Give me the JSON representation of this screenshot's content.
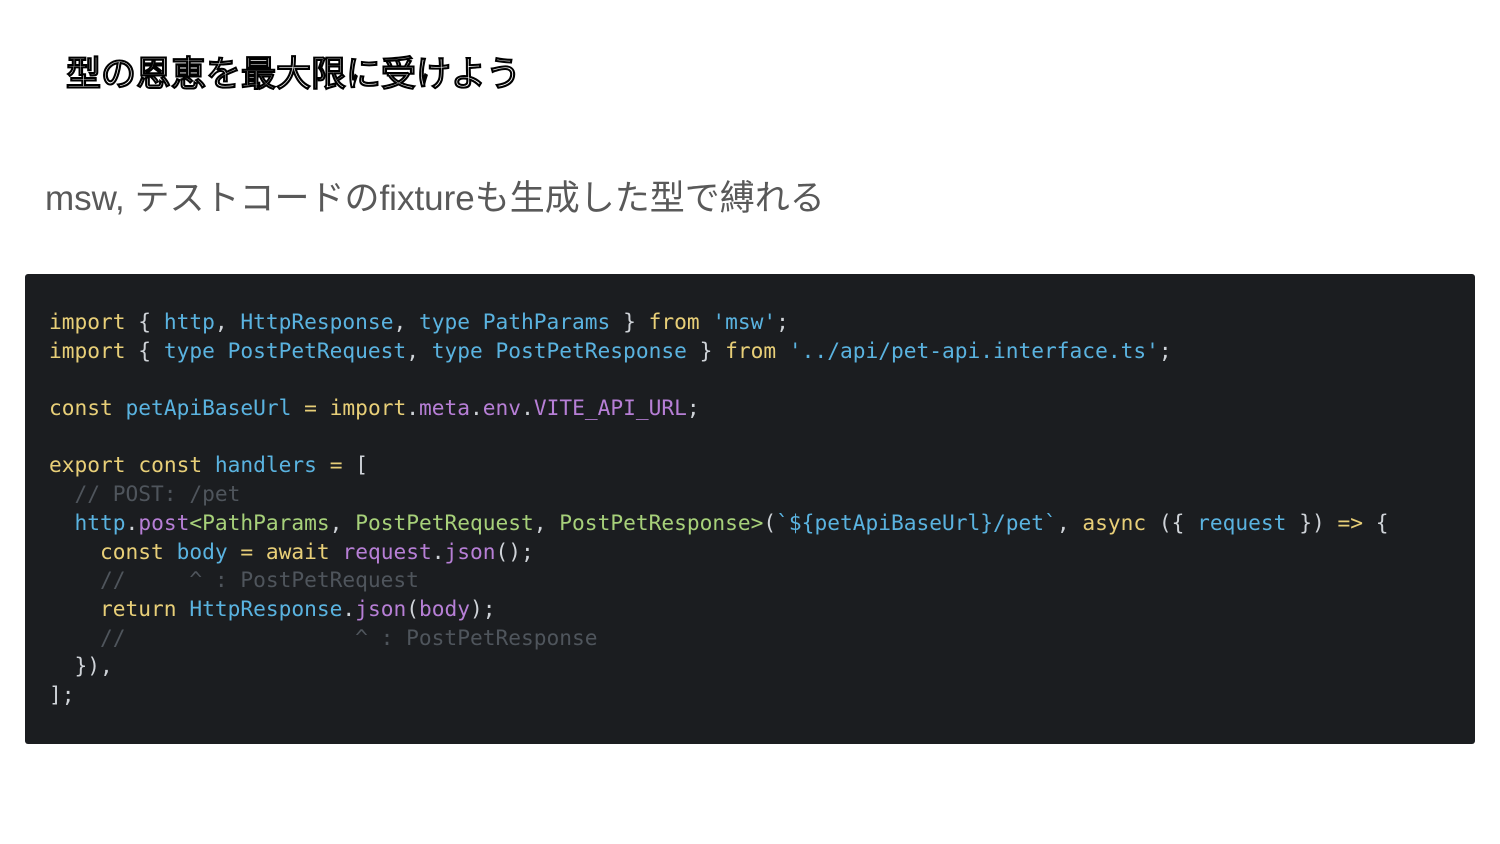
{
  "slide": {
    "title": "型の恩恵を最大限に受けよう",
    "subtitle": "msw, テストコードのfixtureも生成した型で縛れる"
  },
  "code": {
    "lines": [
      {
        "tokens": [
          [
            "kw",
            "import"
          ],
          [
            "op",
            " { "
          ],
          [
            "id",
            "http"
          ],
          [
            "op",
            ", "
          ],
          [
            "id",
            "HttpResponse"
          ],
          [
            "op",
            ", "
          ],
          [
            "id",
            "type PathParams"
          ],
          [
            "op",
            " } "
          ],
          [
            "kw",
            "from"
          ],
          [
            "op",
            " "
          ],
          [
            "str",
            "'msw'"
          ],
          [
            "op",
            ";"
          ]
        ]
      },
      {
        "tokens": [
          [
            "kw",
            "import"
          ],
          [
            "op",
            " { "
          ],
          [
            "id",
            "type PostPetRequest"
          ],
          [
            "op",
            ", "
          ],
          [
            "id",
            "type PostPetResponse"
          ],
          [
            "op",
            " } "
          ],
          [
            "kw",
            "from"
          ],
          [
            "op",
            " "
          ],
          [
            "str",
            "'../api/pet-api.interface.ts'"
          ],
          [
            "op",
            ";"
          ]
        ]
      },
      {
        "tokens": []
      },
      {
        "tokens": [
          [
            "kw",
            "const"
          ],
          [
            "op",
            " "
          ],
          [
            "id",
            "petApiBaseUrl"
          ],
          [
            "op",
            " "
          ],
          [
            "kw",
            "="
          ],
          [
            "op",
            " "
          ],
          [
            "kw",
            "import"
          ],
          [
            "op",
            "."
          ],
          [
            "prop",
            "meta"
          ],
          [
            "op",
            "."
          ],
          [
            "prop",
            "env"
          ],
          [
            "op",
            "."
          ],
          [
            "prop",
            "VITE_API_URL"
          ],
          [
            "op",
            ";"
          ]
        ]
      },
      {
        "tokens": []
      },
      {
        "tokens": [
          [
            "kw",
            "export"
          ],
          [
            "op",
            " "
          ],
          [
            "kw",
            "const"
          ],
          [
            "op",
            " "
          ],
          [
            "id",
            "handlers"
          ],
          [
            "op",
            " "
          ],
          [
            "kw",
            "="
          ],
          [
            "op",
            " ["
          ]
        ]
      },
      {
        "tokens": [
          [
            "cm",
            "  // POST: /pet"
          ]
        ]
      },
      {
        "tokens": [
          [
            "op",
            "  "
          ],
          [
            "id",
            "http"
          ],
          [
            "op",
            "."
          ],
          [
            "fn",
            "post"
          ],
          [
            "typ",
            "<PathParams"
          ],
          [
            "op",
            ", "
          ],
          [
            "typ",
            "PostPetRequest"
          ],
          [
            "op",
            ", "
          ],
          [
            "typ",
            "PostPetResponse>"
          ],
          [
            "op",
            "("
          ],
          [
            "str",
            "`${petApiBaseUrl}/pet`"
          ],
          [
            "op",
            ", "
          ],
          [
            "kw",
            "async"
          ],
          [
            "op",
            " ({ "
          ],
          [
            "id",
            "request"
          ],
          [
            "op",
            " }) "
          ],
          [
            "kw",
            "=>"
          ],
          [
            "op",
            " {"
          ]
        ]
      },
      {
        "tokens": [
          [
            "op",
            "    "
          ],
          [
            "kw",
            "const"
          ],
          [
            "op",
            " "
          ],
          [
            "id",
            "body"
          ],
          [
            "op",
            " "
          ],
          [
            "kw",
            "="
          ],
          [
            "op",
            " "
          ],
          [
            "kw",
            "await"
          ],
          [
            "op",
            " "
          ],
          [
            "prop",
            "request"
          ],
          [
            "op",
            "."
          ],
          [
            "fn",
            "json"
          ],
          [
            "op",
            "();"
          ]
        ]
      },
      {
        "tokens": [
          [
            "cm",
            "    //     ^ : PostPetRequest"
          ]
        ]
      },
      {
        "tokens": [
          [
            "op",
            "    "
          ],
          [
            "kw",
            "return"
          ],
          [
            "op",
            " "
          ],
          [
            "id",
            "HttpResponse"
          ],
          [
            "op",
            "."
          ],
          [
            "fn",
            "json"
          ],
          [
            "op",
            "("
          ],
          [
            "prop",
            "body"
          ],
          [
            "op",
            ");"
          ]
        ]
      },
      {
        "tokens": [
          [
            "cm",
            "    //                  ^ : PostPetResponse"
          ]
        ]
      },
      {
        "tokens": [
          [
            "op",
            "  }),"
          ]
        ]
      },
      {
        "tokens": [
          [
            "op",
            "];"
          ]
        ]
      }
    ]
  },
  "colors": {
    "code_background": "#1b1d20",
    "keyword": "#e8cf78",
    "identifier": "#5ab3e0",
    "property": "#b77fd6",
    "type": "#a7d17a",
    "comment": "#4f555c"
  }
}
